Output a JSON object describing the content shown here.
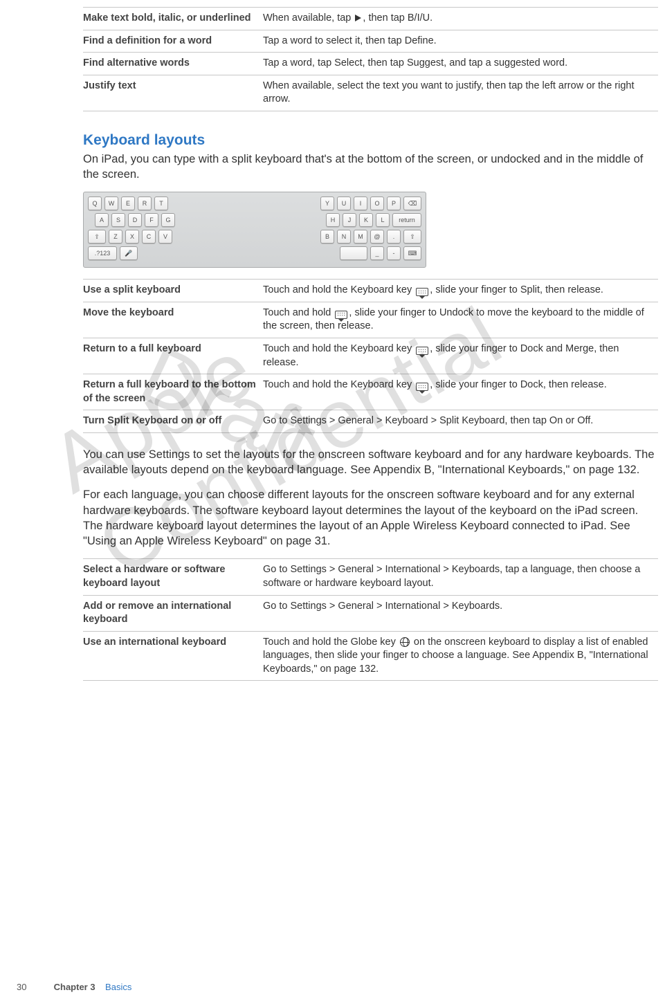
{
  "table1": {
    "rows": [
      {
        "label": "Make text bold, italic, or underlined",
        "value_pre": "When available, tap ",
        "value_post": ", then tap B/I/U."
      },
      {
        "label": "Find a definition for a word",
        "value": "Tap a word to select it, then tap Define."
      },
      {
        "label": "Find alternative words",
        "value": "Tap a word, tap Select, then tap Suggest, and tap a suggested word."
      },
      {
        "label": "Justify text",
        "value": "When available, select the text you want to justify, then tap the left arrow or the right arrow."
      }
    ]
  },
  "section_heading": "Keyboard layouts",
  "intro_para": "On iPad, you can type with a split keyboard that's at the bottom of the screen, or undocked and in the middle of the screen.",
  "keyboard": {
    "left_rows": [
      [
        "Q",
        "W",
        "E",
        "R",
        "T"
      ],
      [
        "A",
        "S",
        "D",
        "F",
        "G"
      ],
      [
        "⇧",
        "Z",
        "X",
        "C",
        "V"
      ],
      [
        ".?123",
        "🎤"
      ]
    ],
    "right_rows": [
      [
        "Y",
        "U",
        "I",
        "O",
        "P",
        "⌫"
      ],
      [
        "H",
        "J",
        "K",
        "L",
        "return"
      ],
      [
        "B",
        "N",
        "M",
        "@",
        ".",
        "⇧"
      ],
      [
        "",
        "_",
        "-",
        "⌨"
      ]
    ]
  },
  "table2": {
    "rows": [
      {
        "label": "Use a split keyboard",
        "pre": "Touch and hold the Keyboard key ",
        "post": ", slide your finger to Split, then release."
      },
      {
        "label": "Move the keyboard",
        "pre": "Touch and hold ",
        "post": ", slide your finger to Undock to move the keyboard to the middle of the screen, then release."
      },
      {
        "label": "Return to a full keyboard",
        "pre": "Touch and hold the Keyboard key ",
        "post": ", slide your finger to Dock and Merge, then release."
      },
      {
        "label": "Return a full keyboard to the bottom of the screen",
        "pre": "Touch and hold the Keyboard key ",
        "post": ", slide your finger to Dock, then release."
      },
      {
        "label": "Turn Split Keyboard on or off",
        "value": "Go to Settings > General > Keyboard > Split Keyboard, then tap On or Off."
      }
    ]
  },
  "para2": "You can use Settings to set the layouts for the onscreen software keyboard and for any hardware keyboards. The available layouts depend on the keyboard language. See Appendix B, \"International Keyboards,\" on page 132.",
  "para3": "For each language, you can choose different layouts for the onscreen software keyboard and for any external hardware keyboards. The software keyboard layout determines the layout of the keyboard on the iPad screen. The hardware keyboard layout determines the layout of an Apple Wireless Keyboard connected to iPad. See \"Using an Apple Wireless Keyboard\" on page 31.",
  "table3": {
    "rows": [
      {
        "label": "Select a hardware or software keyboard layout",
        "value": "Go to Settings > General > International > Keyboards, tap a language, then choose a software or hardware keyboard layout."
      },
      {
        "label": "Add or remove an international keyboard",
        "value": "Go to Settings > General > International > Keyboards."
      },
      {
        "label": "Use an international keyboard",
        "pre": "Touch and hold the Globe key ",
        "post": " on the onscreen keyboard to display a list of enabled languages, then slide your finger to choose a language. See Appendix B, \"International Keyboards,\" on page 132."
      }
    ]
  },
  "watermarks": {
    "draft": "Draft",
    "confidential": "Apple Confidential"
  },
  "footer": {
    "page": "30",
    "chapter": "Chapter 3",
    "title": "Basics"
  }
}
